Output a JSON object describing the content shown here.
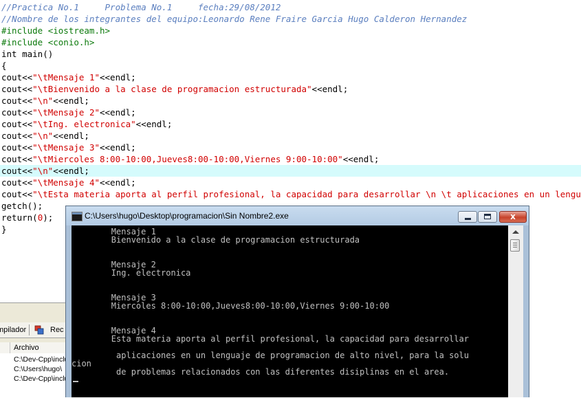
{
  "editor": {
    "lines": [
      {
        "type": "comment",
        "text": "//Practica No.1     Problema No.1     fecha:29/08/2012"
      },
      {
        "type": "comment",
        "text": "//Nombre de los integrantes del equipo:Leonardo Rene Fraire Garcia Hugo Calderon Hernandez"
      },
      {
        "type": "preproc",
        "text": "#include <iostream.h>"
      },
      {
        "type": "preproc",
        "text": "#include <conio.h>"
      },
      {
        "type": "code",
        "text": "int main()"
      },
      {
        "type": "code",
        "text": "{"
      },
      {
        "type": "cout",
        "pre": "cout<<",
        "str": "\"\\tMensaje 1\"",
        "post": "<<endl;"
      },
      {
        "type": "cout",
        "pre": "cout<<",
        "str": "\"\\tBienvenido a la clase de programacion estructurada\"",
        "post": "<<endl;"
      },
      {
        "type": "cout",
        "pre": "cout<<",
        "str": "\"\\n\"",
        "post": "<<endl;"
      },
      {
        "type": "cout",
        "pre": "cout<<",
        "str": "\"\\tMensaje 2\"",
        "post": "<<endl;"
      },
      {
        "type": "cout",
        "pre": "cout<<",
        "str": "\"\\tIng. electronica\"",
        "post": "<<endl;"
      },
      {
        "type": "cout",
        "pre": "cout<<",
        "str": "\"\\n\"",
        "post": "<<endl;"
      },
      {
        "type": "cout",
        "pre": "cout<<",
        "str": "\"\\tMensaje 3\"",
        "post": "<<endl;"
      },
      {
        "type": "cout",
        "pre": "cout<<",
        "str": "\"\\tMiercoles 8:00-10:00,Jueves8:00-10:00,Viernes 9:00-10:00\"",
        "post": "<<endl;"
      },
      {
        "type": "cout",
        "pre": "cout<<",
        "str": "\"\\n\"",
        "post": "<<endl;",
        "highlight": true
      },
      {
        "type": "cout",
        "pre": "cout<<",
        "str": "\"\\tMensaje 4\"",
        "post": "<<endl;"
      },
      {
        "type": "cout",
        "pre": "cout<<",
        "str": "\"\\tEsta materia aporta al perfil profesional, la capacidad para desarrollar \\n \\t aplicaciones en un lenguaje",
        "post": ""
      },
      {
        "type": "code",
        "text": "getch();"
      },
      {
        "type": "return",
        "pre": "return(",
        "num": "0",
        "post": ");"
      },
      {
        "type": "code",
        "text": "}"
      }
    ]
  },
  "bottom_panel": {
    "tab_compiler": "mpilador",
    "tab_resources": "Rec",
    "file_column": "Archivo",
    "files": [
      "C:\\Dev-Cpp\\include",
      "C:\\Users\\hugo\\",
      "C:\\Dev-Cpp\\include"
    ]
  },
  "console": {
    "title": "C:\\Users\\hugo\\Desktop\\programacion\\Sin Nombre2.exe",
    "close_glyph": "x",
    "lines": [
      "        Mensaje 1",
      "        Bienvenido a la clase de programacion estructurada",
      "",
      "",
      "        Mensaje 2",
      "        Ing. electronica",
      "",
      "",
      "        Mensaje 3",
      "        Miercoles 8:00-10:00,Jueves8:00-10:00,Viernes 9:00-10:00",
      "",
      "",
      "        Mensaje 4",
      "        Esta materia aporta al perfil profesional, la capacidad para desarrollar",
      "",
      "         aplicaciones en un lenguaje de programacion de alto nivel, para la solu",
      "cion",
      "         de problemas relacionados con las diferentes disiplinas en el area.",
      ""
    ]
  },
  "colors": {
    "comment": "#5b7fbf",
    "preprocessor": "#0c7a0c",
    "string": "#d10000",
    "highlight_line": "#d5fbfc",
    "console_bg": "#000000",
    "console_text": "#c0c0c0"
  },
  "icons": {
    "window_icon": "console-app-icon",
    "minimize": "minimize-icon",
    "maximize": "maximize-icon",
    "close": "close-icon",
    "resources_tab": "resources-icon",
    "scroll_up": "scroll-up-arrow-icon"
  }
}
